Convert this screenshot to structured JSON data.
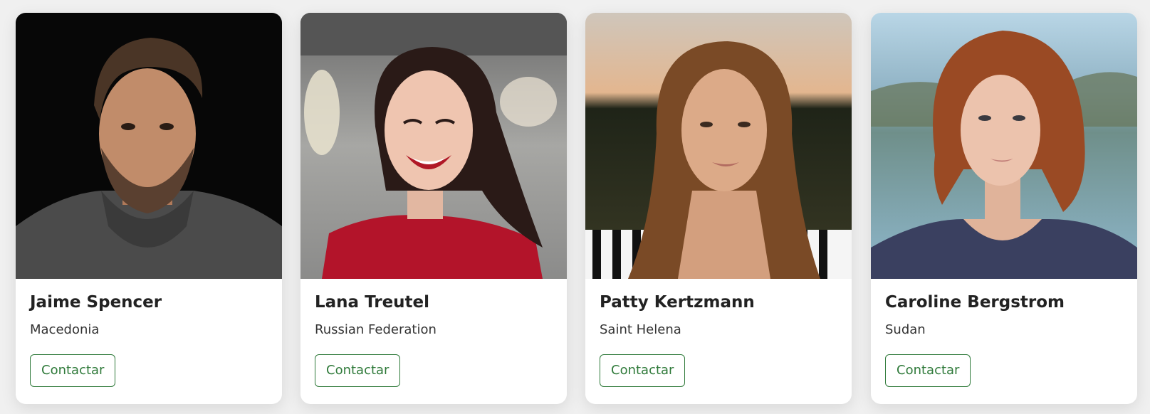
{
  "cards": [
    {
      "name": "Jaime Spencer",
      "country": "Macedonia",
      "button_label": "Contactar"
    },
    {
      "name": "Lana Treutel",
      "country": "Russian Federation",
      "button_label": "Contactar"
    },
    {
      "name": "Patty Kertzmann",
      "country": "Saint Helena",
      "button_label": "Contactar"
    },
    {
      "name": "Caroline Bergstrom",
      "country": "Sudan",
      "button_label": "Contactar"
    }
  ],
  "colors": {
    "accent": "#2f7a3a",
    "page_background": "#f0f0f0",
    "card_background": "#ffffff"
  }
}
